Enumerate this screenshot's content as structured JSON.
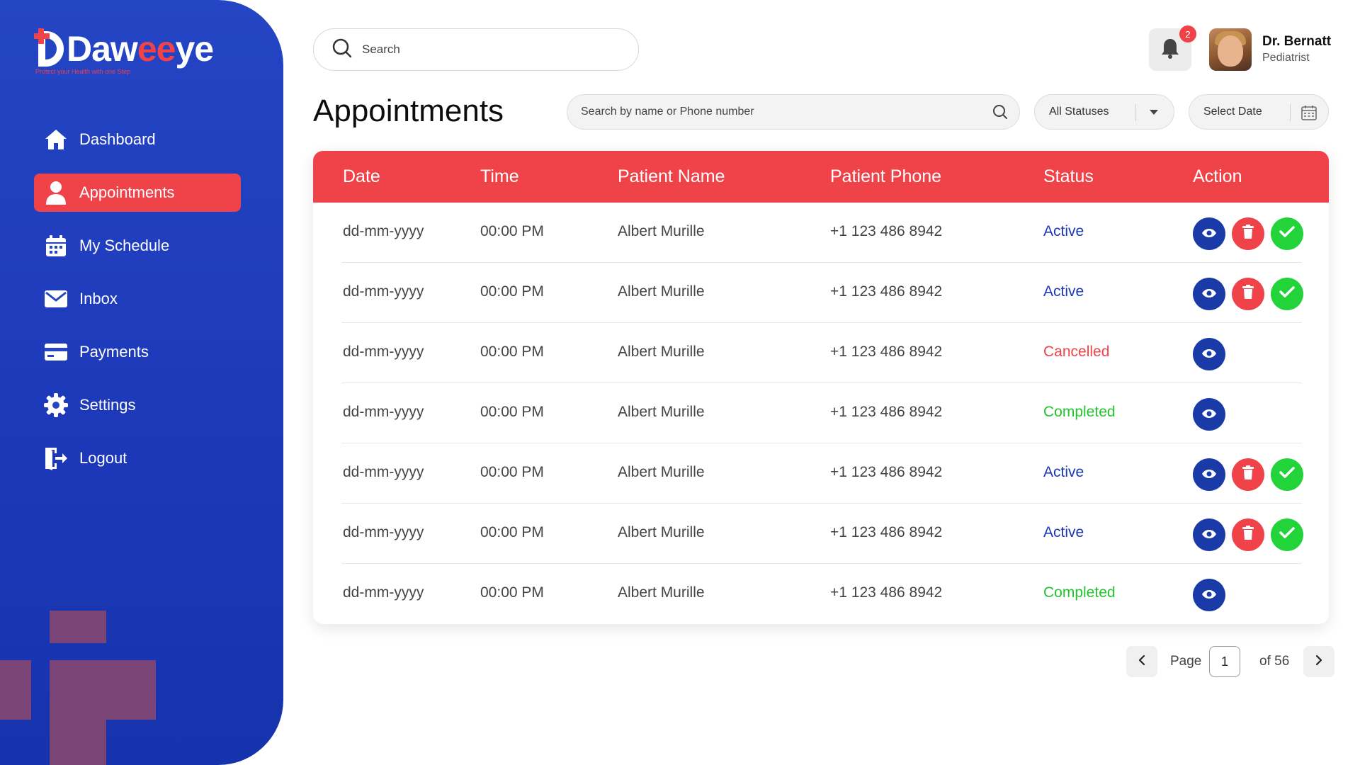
{
  "brand": {
    "name_part1": "Daw",
    "name_part2": "ee",
    "name_part3": "ye",
    "tagline": "Protect your Health with one Step",
    "primary_color": "#2445c4",
    "accent_color": "#ef4249"
  },
  "sidebar": {
    "items": [
      {
        "label": "Dashboard",
        "icon": "home-icon"
      },
      {
        "label": "Appointments",
        "icon": "user-icon",
        "active": true
      },
      {
        "label": "My Schedule",
        "icon": "calendar-icon"
      },
      {
        "label": "Inbox",
        "icon": "mail-icon"
      },
      {
        "label": "Payments",
        "icon": "card-icon"
      },
      {
        "label": "Settings",
        "icon": "gear-icon"
      },
      {
        "label": "Logout",
        "icon": "logout-icon"
      }
    ]
  },
  "topbar": {
    "search_placeholder": "Search",
    "notification_count": "2",
    "user_name": "Dr. Bernatt",
    "user_role": "Pediatrist"
  },
  "page": {
    "title": "Appointments",
    "filter_search_placeholder": "Search by name or Phone number",
    "status_filter": "All Statuses",
    "date_filter": "Select Date"
  },
  "table": {
    "columns": [
      "Date",
      "Time",
      "Patient Name",
      "Patient Phone",
      "Status",
      "Action"
    ],
    "rows": [
      {
        "date": "dd-mm-yyyy",
        "time": "00:00 PM",
        "name": "Albert Murille",
        "phone": "+1 123 486 8942",
        "status": "Active"
      },
      {
        "date": "dd-mm-yyyy",
        "time": "00:00 PM",
        "name": "Albert Murille",
        "phone": "+1 123 486 8942",
        "status": "Active"
      },
      {
        "date": "dd-mm-yyyy",
        "time": "00:00 PM",
        "name": "Albert Murille",
        "phone": "+1 123 486 8942",
        "status": "Cancelled"
      },
      {
        "date": "dd-mm-yyyy",
        "time": "00:00 PM",
        "name": "Albert Murille",
        "phone": "+1 123 486 8942",
        "status": "Completed"
      },
      {
        "date": "dd-mm-yyyy",
        "time": "00:00 PM",
        "name": "Albert Murille",
        "phone": "+1 123 486 8942",
        "status": "Active"
      },
      {
        "date": "dd-mm-yyyy",
        "time": "00:00 PM",
        "name": "Albert Murille",
        "phone": "+1 123 486 8942",
        "status": "Active"
      },
      {
        "date": "dd-mm-yyyy",
        "time": "00:00 PM",
        "name": "Albert Murille",
        "phone": "+1 123 486 8942",
        "status": "Completed"
      }
    ]
  },
  "pagination": {
    "page_label": "Page",
    "current_page": "1",
    "total_label": "of 56"
  }
}
